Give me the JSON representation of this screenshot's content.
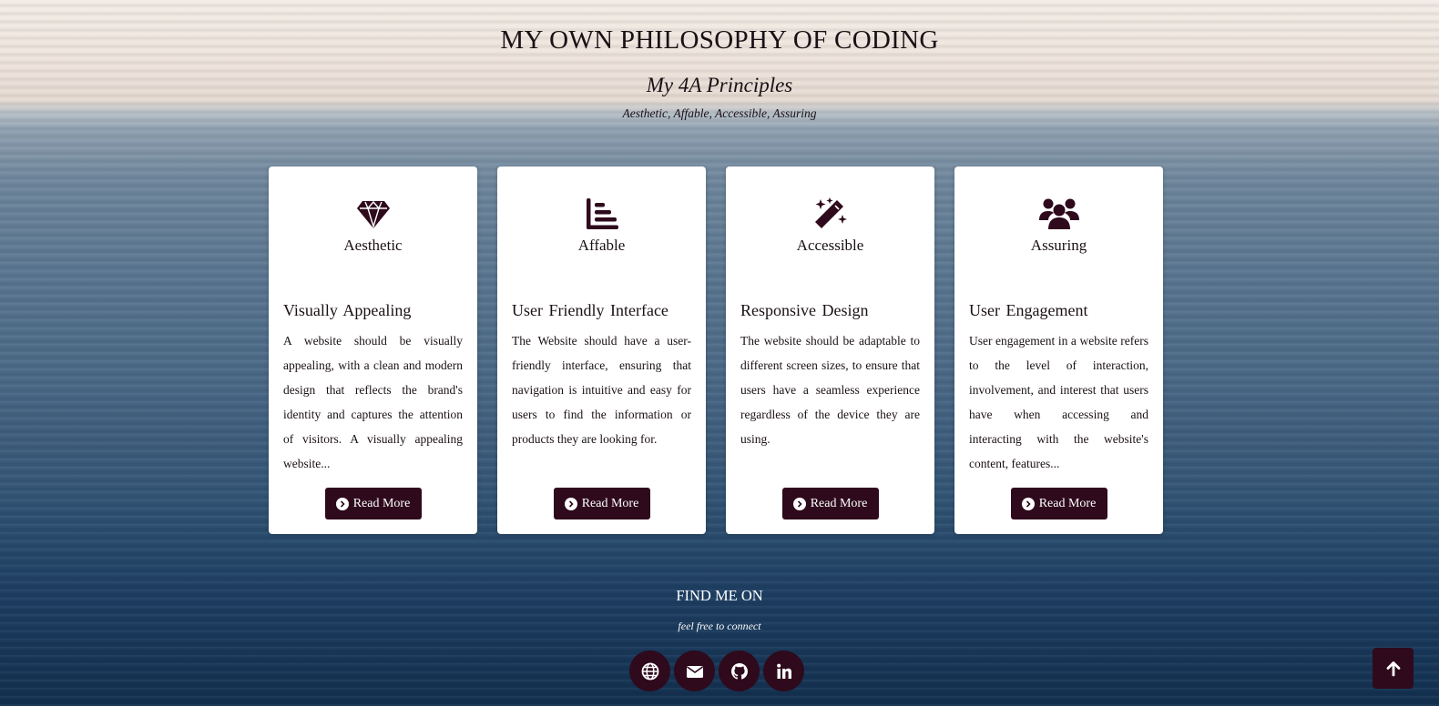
{
  "header": {
    "title": "MY OWN PHILOSOPHY OF CODING",
    "subtitle": "My 4A Principles",
    "tagline": "Aesthetic, Affable, Accessible, Assuring"
  },
  "cards": [
    {
      "icon": "gem-icon",
      "label": "Aesthetic",
      "heading": "Visually Appealing",
      "text": "A website should be visually appealing, with a clean and modern design that reflects the brand's identity and captures the attention of visitors. A visually appealing website...",
      "button": "Read More"
    },
    {
      "icon": "bar-chart-icon",
      "label": "Affable",
      "heading": "User Friendly Interface",
      "text": "The Website should have a user-friendly interface, ensuring that navigation is intuitive and easy for users to find the information or products they are looking for.",
      "button": "Read More"
    },
    {
      "icon": "magic-wand-icon",
      "label": "Accessible",
      "heading": "Responsive Design",
      "text": "The website should be adaptable to different screen sizes, to ensure that users have a seamless experience regardless of the device they are using.",
      "button": "Read More"
    },
    {
      "icon": "users-icon",
      "label": "Assuring",
      "heading": "User Engagement",
      "text": "User engagement in a website refers to the level of interaction, involvement, and interest that users have when accessing and interacting with the website's content, features...",
      "button": "Read More"
    }
  ],
  "footer": {
    "title": "FIND ME ON",
    "subtitle": "feel free to connect",
    "socials": [
      "globe-icon",
      "envelope-icon",
      "github-icon",
      "linkedin-icon"
    ]
  },
  "colors": {
    "accent": "#2e0a1c",
    "card_bg": "#ffffff",
    "text": "#1a1015"
  }
}
